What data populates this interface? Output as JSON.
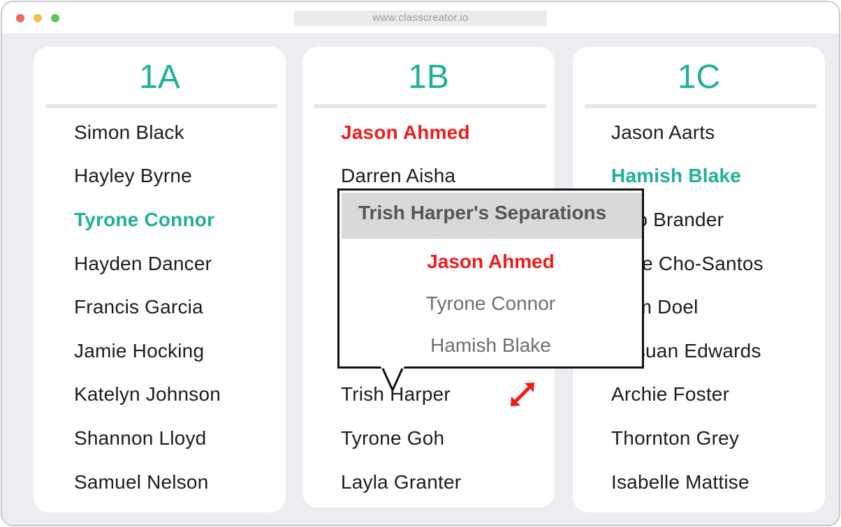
{
  "browser": {
    "url": "www.classcreator.io"
  },
  "classes": [
    {
      "title": "1A",
      "students": [
        {
          "name": "Simon Black",
          "state": "normal"
        },
        {
          "name": "Hayley Byrne",
          "state": "normal"
        },
        {
          "name": "Tyrone Connor",
          "state": "highlight"
        },
        {
          "name": "Hayden Dancer",
          "state": "normal"
        },
        {
          "name": "Francis Garcia",
          "state": "normal"
        },
        {
          "name": "Jamie Hocking",
          "state": "normal"
        },
        {
          "name": "Katelyn Johnson",
          "state": "normal"
        },
        {
          "name": "Shannon Lloyd",
          "state": "normal"
        },
        {
          "name": "Samuel Nelson",
          "state": "normal"
        }
      ]
    },
    {
      "title": "1B",
      "students": [
        {
          "name": "Jason Ahmed",
          "state": "conflict"
        },
        {
          "name": "Darren Aisha",
          "state": "normal"
        },
        {
          "name": "Trish Harper",
          "state": "normal"
        },
        {
          "name": "Tyrone Goh",
          "state": "normal"
        },
        {
          "name": "Layla Granter",
          "state": "normal"
        }
      ]
    },
    {
      "title": "1C",
      "students": [
        {
          "name": "Jason Aarts",
          "state": "normal"
        },
        {
          "name": "Hamish Blake",
          "state": "highlight"
        },
        {
          "name": "Milo Brander",
          "state": "normal"
        },
        {
          "name": "Jake Cho-Santos",
          "state": "normal"
        },
        {
          "name": "Sam Doel",
          "state": "normal"
        },
        {
          "name": "Ki-suan Edwards",
          "state": "normal"
        },
        {
          "name": "Archie Foster",
          "state": "normal"
        },
        {
          "name": "Thornton Grey",
          "state": "normal"
        },
        {
          "name": "Isabelle Mattise",
          "state": "normal"
        }
      ]
    }
  ],
  "separations_popup": {
    "title": "Trish Harper's Separations",
    "items": [
      {
        "name": "Jason Ahmed",
        "state": "conflict"
      },
      {
        "name": "Tyrone Connor",
        "state": "normal"
      },
      {
        "name": "Hamish Blake",
        "state": "normal"
      }
    ]
  },
  "colors": {
    "accent": "#1fb195",
    "conflict": "#ee1c1c",
    "background": "#ecedf0"
  },
  "icons": {
    "swap": "diagonal-double-arrow-icon"
  }
}
